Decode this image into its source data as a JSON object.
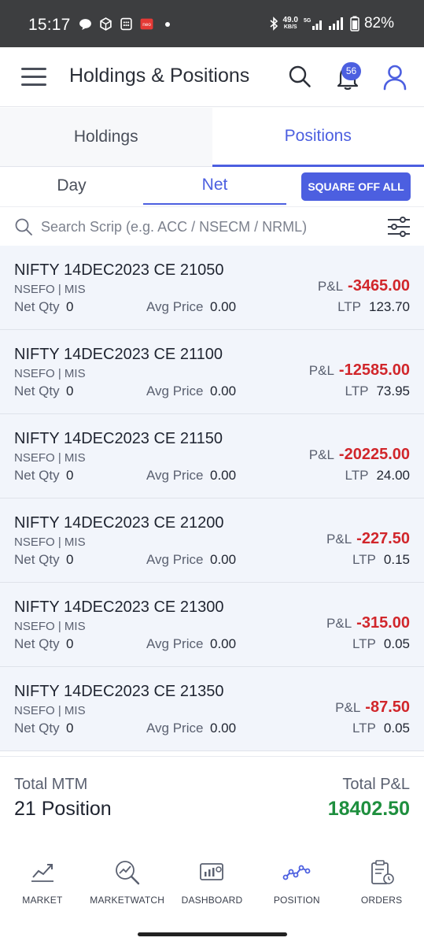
{
  "status_bar": {
    "time": "15:17",
    "net_speed": "49.0",
    "net_speed_unit": "KB/S",
    "battery": "82%"
  },
  "header": {
    "title": "Holdings & Positions",
    "notification_count": "56"
  },
  "tabs": {
    "holdings": "Holdings",
    "positions": "Positions"
  },
  "sub_tabs": {
    "day": "Day",
    "net": "Net",
    "square_off": "SQUARE OFF ALL"
  },
  "search": {
    "placeholder": "Search Scrip (e.g. ACC / NSECM / NRML)"
  },
  "labels": {
    "net_qty": "Net Qty",
    "avg_price": "Avg Price",
    "pnl": "P&L",
    "ltp": "LTP"
  },
  "positions": [
    {
      "name": "NIFTY 14DEC2023 CE 21050",
      "exchange": "NSEFO | MIS",
      "net_qty": "0",
      "avg_price": "0.00",
      "pnl": "-3465.00",
      "ltp": "123.70"
    },
    {
      "name": "NIFTY 14DEC2023 CE 21100",
      "exchange": "NSEFO | MIS",
      "net_qty": "0",
      "avg_price": "0.00",
      "pnl": "-12585.00",
      "ltp": "73.95"
    },
    {
      "name": "NIFTY 14DEC2023 CE 21150",
      "exchange": "NSEFO | MIS",
      "net_qty": "0",
      "avg_price": "0.00",
      "pnl": "-20225.00",
      "ltp": "24.00"
    },
    {
      "name": "NIFTY 14DEC2023 CE 21200",
      "exchange": "NSEFO | MIS",
      "net_qty": "0",
      "avg_price": "0.00",
      "pnl": "-227.50",
      "ltp": "0.15"
    },
    {
      "name": "NIFTY 14DEC2023 CE 21300",
      "exchange": "NSEFO | MIS",
      "net_qty": "0",
      "avg_price": "0.00",
      "pnl": "-315.00",
      "ltp": "0.05"
    },
    {
      "name": "NIFTY 14DEC2023 CE 21350",
      "exchange": "NSEFO | MIS",
      "net_qty": "0",
      "avg_price": "0.00",
      "pnl": "-87.50",
      "ltp": "0.05"
    }
  ],
  "summary": {
    "mtm_label": "Total MTM",
    "positions": "21 Position",
    "pnl_label": "Total P&L",
    "pnl_value": "18402.50"
  },
  "bottom_nav": {
    "market": "MARKET",
    "marketwatch": "MARKETWATCH",
    "dashboard": "DASHBOARD",
    "position": "POSITION",
    "orders": "ORDERS"
  },
  "colors": {
    "accent": "#4c5fe0",
    "loss": "#d1262b",
    "profit": "#1e8f3e",
    "row_bg": "#f2f5fb"
  }
}
